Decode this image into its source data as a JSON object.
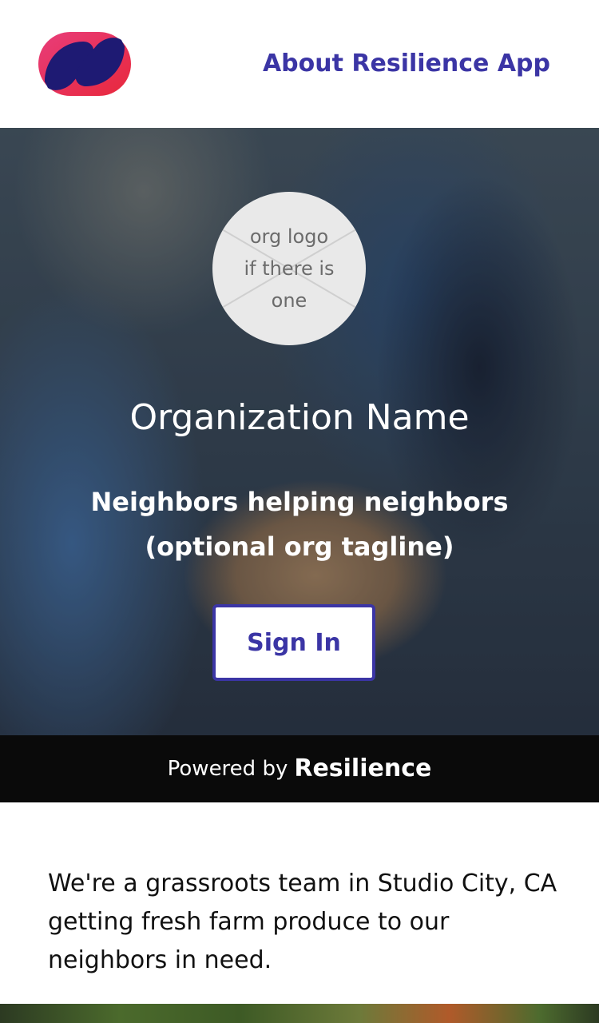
{
  "header": {
    "about_link": "About Resilience App"
  },
  "hero": {
    "org_logo_placeholder": "org logo\nif there is\none",
    "org_name": "Organization Name",
    "tagline": "Neighbors helping neighbors\n(optional org tagline)",
    "signin_label": "Sign In"
  },
  "footer_band": {
    "prefix": "Powered by",
    "brand": "Resilience"
  },
  "description": "We're a grassroots team in Studio City, CA getting fresh farm produce to our neighbors in need.",
  "colors": {
    "accent": "#3B35A5",
    "logo_red": "#E8283C",
    "logo_pink": "#E83D7A",
    "logo_navy": "#1E1A73",
    "band": "#0A0A0A"
  },
  "icons": {
    "app_logo": "resilience-logo-icon",
    "org_logo": "image-placeholder-icon"
  }
}
